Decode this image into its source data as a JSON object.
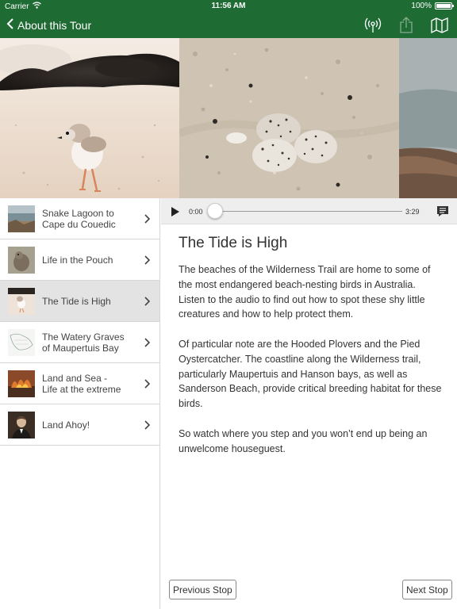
{
  "status_bar": {
    "carrier": "Carrier",
    "time": "11:56 AM",
    "battery": "100%",
    "battery_level": 1.0
  },
  "nav": {
    "back_label": "About this Tour",
    "icons": [
      "broadcast-icon",
      "share-icon",
      "map-icon"
    ]
  },
  "tour_stops": [
    {
      "label": "Snake Lagoon to\nCape du Couedic",
      "thumbnail": "lagoon-thumbnail",
      "selected": false
    },
    {
      "label": "Life in the Pouch",
      "thumbnail": "wallaby-thumbnail",
      "selected": false
    },
    {
      "label": "The Tide is High",
      "thumbnail": "plover-thumbnail",
      "selected": true
    },
    {
      "label": "The Watery Graves\nof Maupertuis Bay",
      "thumbnail": "map-thumbnail",
      "selected": false
    },
    {
      "label": "Land and Sea -\nLife at the extreme",
      "thumbnail": "fire-thumbnail",
      "selected": false
    },
    {
      "label": "Land Ahoy!",
      "thumbnail": "portrait-thumbnail",
      "selected": false
    }
  ],
  "player": {
    "current_time": "0:00",
    "total_time": "3:29",
    "progress": 0.0
  },
  "content": {
    "title": "The Tide is High",
    "paragraphs": [
      "The beaches of the Wilderness Trail are home to some of the most endangered beach-nesting birds in Australia. Listen to the audio to find out how to spot these shy little creatures and how to help protect them.",
      "Of particular note are the Hooded Plovers and the Pied Oystercatcher. The coastline along the Wilderness trail, particularly Maupertuis and Hanson bays, as well as Sanderson Beach, provide critical breeding habitat for these birds.",
      "So watch where you step and you won’t end up being an unwelcome houseguest."
    ]
  },
  "footer": {
    "previous_label": "Previous Stop",
    "next_label": "Next Stop"
  },
  "colors": {
    "header": "#1f6b34",
    "selected_row": "#e3e3e3"
  }
}
